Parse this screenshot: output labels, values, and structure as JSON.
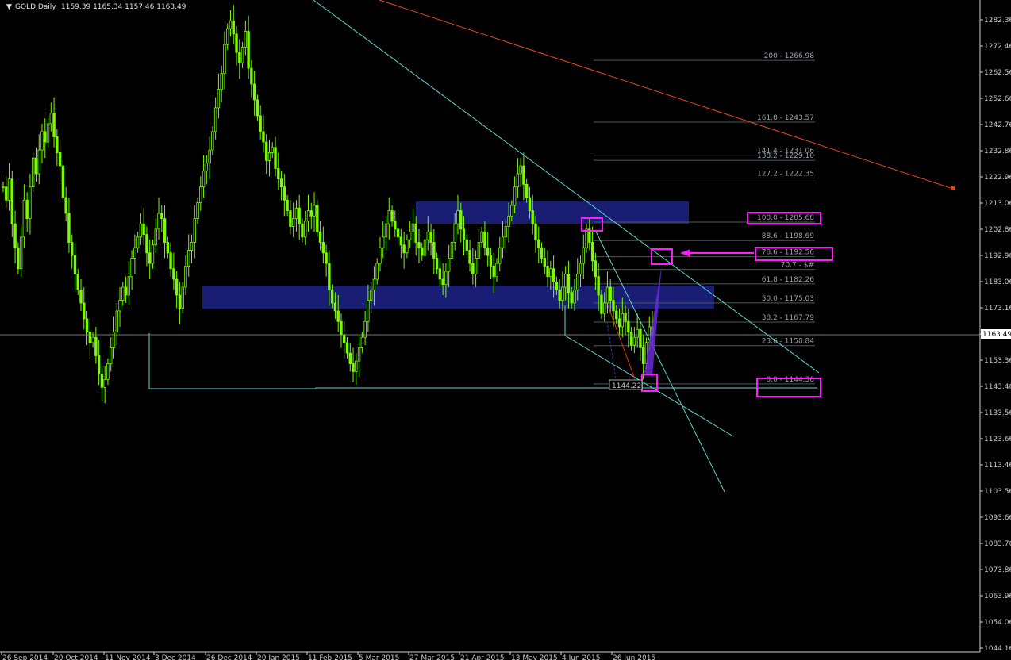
{
  "header": {
    "symbol": "GOLD,Daily",
    "ohlc": "1159.39 1165.34 1157.46 1163.49"
  },
  "price_axis": {
    "labels": [
      "1282.36",
      "1272.46",
      "1262.56",
      "1252.66",
      "1242.76",
      "1232.86",
      "1222.96",
      "1213.06",
      "1202.86",
      "1192.96",
      "1183.06",
      "1173.16",
      "1163.49",
      "1153.36",
      "1143.46",
      "1133.56",
      "1123.66",
      "1113.46",
      "1103.56",
      "1093.66",
      "1083.76",
      "1073.86",
      "1063.96",
      "1054.06",
      "1044.16"
    ],
    "current_price": "1163.49"
  },
  "time_axis": {
    "labels": [
      "26 Sep 2014",
      "20 Oct 2014",
      "11 Nov 2014",
      "3 Dec 2014",
      "26 Dec 2014",
      "20 Jan 2015",
      "11 Feb 2015",
      "5 Mar 2015",
      "27 Mar 2015",
      "21 Apr 2015",
      "13 May 2015",
      "4 Jun 2015",
      "26 Jun 2015"
    ]
  },
  "fibonacci": {
    "levels": [
      {
        "label": "200 - 1266.98",
        "value": 1266.98
      },
      {
        "label": "161.8 - 1243.57",
        "value": 1243.57
      },
      {
        "label": "141.4 - 1231.06",
        "value": 1231.06
      },
      {
        "label": "138.2 - 1229.10",
        "value": 1229.1
      },
      {
        "label": "127.2 - 1222.35",
        "value": 1222.35
      },
      {
        "label": "100.0 - 1205.68",
        "value": 1205.68
      },
      {
        "label": "88.6 - 1198.69",
        "value": 1198.69
      },
      {
        "label": "78.6 - 1192.56",
        "value": 1192.56
      },
      {
        "label": "70.7 - $#",
        "value": 1187.72
      },
      {
        "label": "61.8 - 1182.26",
        "value": 1182.26
      },
      {
        "label": "50.0 - 1175.03",
        "value": 1175.03
      },
      {
        "label": "38.2 - 1167.79",
        "value": 1167.79
      },
      {
        "label": "23.6 - 1158.84",
        "value": 1158.84
      },
      {
        "label": "0.0 - 1144.36",
        "value": 1144.36
      }
    ]
  },
  "annotations": {
    "low_label": "1144.22"
  },
  "colors": {
    "candle": "#7cfc00",
    "zone": "#1a1f7a",
    "trendline_cyan": "#5fd3d3",
    "trendline_red": "#e04a1a",
    "highlight": "#ff1aff"
  },
  "chart_data": {
    "type": "candlestick",
    "title": "GOLD,Daily",
    "ylim": [
      1044.16,
      1287.5
    ],
    "close_series": [
      1219,
      1214,
      1222,
      1205,
      1196,
      1188,
      1200,
      1214,
      1207,
      1219,
      1230,
      1224,
      1233,
      1240,
      1236,
      1243,
      1247,
      1238,
      1232,
      1227,
      1215,
      1209,
      1198,
      1193,
      1186,
      1180,
      1175,
      1169,
      1164,
      1160,
      1162,
      1155,
      1148,
      1143,
      1146,
      1152,
      1158,
      1164,
      1172,
      1176,
      1181,
      1178,
      1185,
      1192,
      1196,
      1200,
      1205,
      1201,
      1194,
      1190,
      1197,
      1203,
      1209,
      1207,
      1198,
      1194,
      1188,
      1184,
      1178,
      1173,
      1181,
      1189,
      1195,
      1198,
      1207,
      1213,
      1219,
      1225,
      1228,
      1233,
      1240,
      1249,
      1256,
      1262,
      1273,
      1279,
      1282,
      1277,
      1270,
      1266,
      1272,
      1278,
      1264,
      1258,
      1252,
      1246,
      1240,
      1236,
      1229,
      1232,
      1234,
      1226,
      1222,
      1219,
      1214,
      1210,
      1204,
      1207,
      1211,
      1205,
      1200,
      1206,
      1210,
      1208,
      1212,
      1202,
      1198,
      1194,
      1190,
      1180,
      1175,
      1172,
      1168,
      1163,
      1160,
      1156,
      1152,
      1149,
      1153,
      1158,
      1162,
      1168,
      1176,
      1180,
      1184,
      1190,
      1196,
      1200,
      1205,
      1210,
      1206,
      1203,
      1200,
      1197,
      1194,
      1199,
      1202,
      1205,
      1198,
      1196,
      1193,
      1199,
      1202,
      1198,
      1192,
      1188,
      1184,
      1182,
      1187,
      1192,
      1198,
      1205,
      1210,
      1203,
      1199,
      1195,
      1190,
      1186,
      1192,
      1198,
      1202,
      1196,
      1193,
      1189,
      1185,
      1190,
      1196,
      1200,
      1204,
      1208,
      1212,
      1219,
      1224,
      1227,
      1220,
      1215,
      1210,
      1205,
      1199,
      1196,
      1192,
      1189,
      1185,
      1188,
      1183,
      1180,
      1176,
      1181,
      1186,
      1179,
      1175,
      1180,
      1186,
      1190,
      1196,
      1203,
      1198,
      1191,
      1185,
      1178,
      1171,
      1175,
      1181,
      1176,
      1172,
      1169,
      1166,
      1171,
      1168,
      1164,
      1159,
      1162,
      1165,
      1158,
      1152,
      1160,
      1166,
      1163
    ]
  }
}
